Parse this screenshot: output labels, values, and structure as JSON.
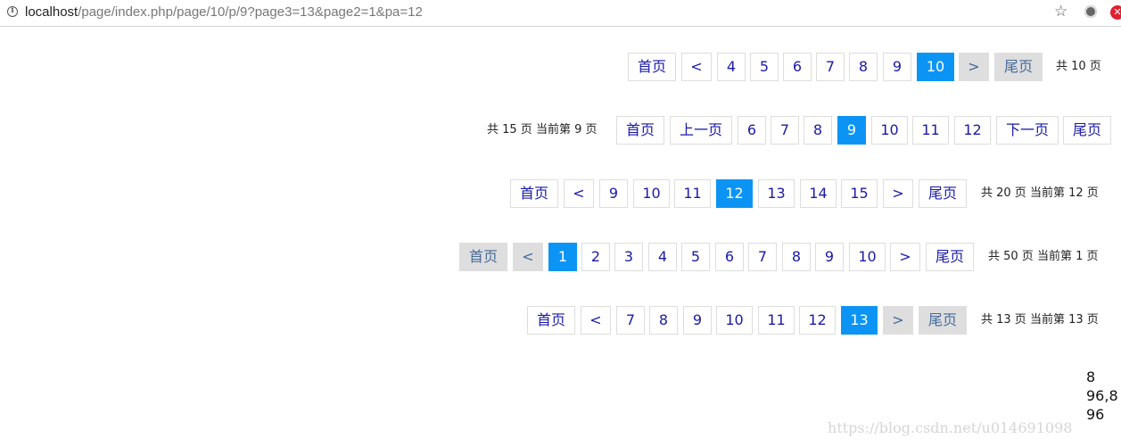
{
  "browser": {
    "url_host": "localhost",
    "url_path": "/page/index.php/page/10/p/9?page3=13&page2=1&pa=12"
  },
  "pagers": [
    {
      "summary": "共 10 页",
      "items": [
        "首页",
        "<",
        "4",
        "5",
        "6",
        "7",
        "8",
        "9",
        "10",
        ">",
        "尾页"
      ],
      "active": "10"
    },
    {
      "summary": "共 15 页 当前第 9 页",
      "items": [
        "首页",
        "上一页",
        "6",
        "7",
        "8",
        "9",
        "10",
        "11",
        "12",
        "下一页",
        "尾页"
      ],
      "active": "9"
    },
    {
      "summary": "共 20 页 当前第 12 页",
      "items": [
        "首页",
        "<",
        "9",
        "10",
        "11",
        "12",
        "13",
        "14",
        "15",
        ">",
        "尾页"
      ],
      "active": "12"
    },
    {
      "summary": "共 50 页 当前第 1 页",
      "items": [
        "首页",
        "<",
        "1",
        "2",
        "3",
        "4",
        "5",
        "6",
        "7",
        "8",
        "9",
        "10",
        ">",
        "尾页"
      ],
      "active": "1"
    },
    {
      "summary": "共 13 页 当前第 13 页",
      "items": [
        "首页",
        "<",
        "7",
        "8",
        "9",
        "10",
        "11",
        "12",
        "13",
        ">",
        "尾页"
      ],
      "active": "13"
    }
  ],
  "output_lines": [
    "8",
    "96,8",
    "96"
  ],
  "watermark": "https://blog.csdn.net/u014691098"
}
